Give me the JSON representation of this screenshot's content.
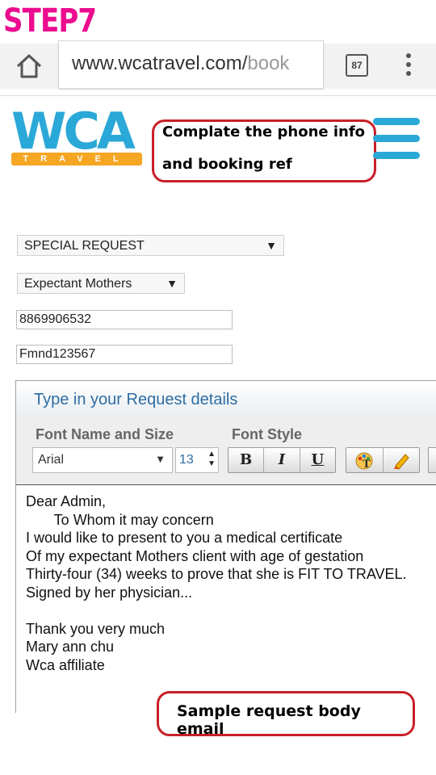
{
  "step_label": "STEP7",
  "browser": {
    "url_main": "www.wcatravel.com/",
    "url_dim": "book",
    "tab_count": "87",
    "icons": [
      "home-icon",
      "tabs-icon",
      "overflow-menu-icon"
    ]
  },
  "logo": {
    "wordmark": "WCA",
    "tagline": "TRAVEL"
  },
  "annotations": {
    "top_line1": "Complate the phone info",
    "top_line2": "and booking ref",
    "bottom": "Sample request body email"
  },
  "form": {
    "special_request": "SPECIAL REQUEST",
    "request_type": "Expectant Mothers",
    "phone": "8869906532",
    "booking_ref": "Fmnd123567"
  },
  "editor": {
    "title": "Type in your Request details",
    "font_label": "Font Name and Size",
    "style_label": "Font Style",
    "font_name": "Arial",
    "font_size": "13",
    "bold": "B",
    "italic": "I",
    "underline": "U",
    "body_lines": [
      "Dear Admin,",
      "       To Whom it may concern",
      "I would like to present to you a medical certificate",
      "Of my expectant Mothers client with age of gestation",
      "Thirty-four (34) weeks to prove that she is FIT TO TRAVEL.",
      "Signed by her physician...",
      "",
      "Thank you very much",
      "Mary ann chu",
      "Wca affiliate"
    ]
  },
  "colors": {
    "step_pink": "#ec0c8f",
    "brand_blue": "#2aa8d8",
    "brand_orange": "#f5a623",
    "callout_red": "#c82027",
    "link_blue": "#2e6da4"
  }
}
